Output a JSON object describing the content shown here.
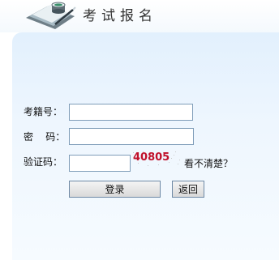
{
  "header": {
    "title": "考试报名",
    "icon": "stationery-icon"
  },
  "form": {
    "exam_id_label": "考籍号：",
    "exam_id_value": "",
    "password_label": "密    码：",
    "password_value": "",
    "captcha_label": "验证码：",
    "captcha_value": "",
    "captcha_image_text": "40805",
    "refresh_text": "看不清楚？"
  },
  "buttons": {
    "login": "登录",
    "back": "返回"
  },
  "colors": {
    "panel_top": "#e2f0fd",
    "panel_bottom": "#f6fbff",
    "input_border": "#7f9db9",
    "captcha_text": "#c0102a"
  }
}
